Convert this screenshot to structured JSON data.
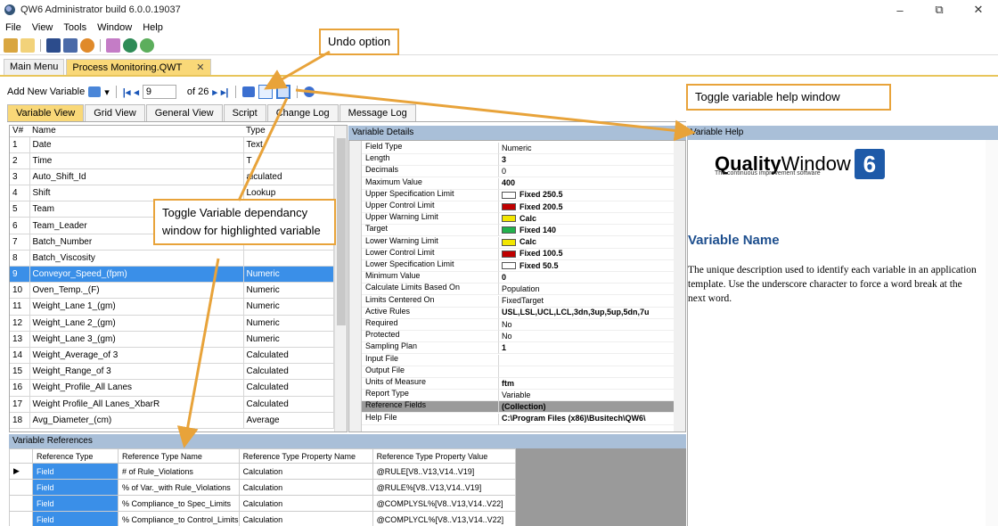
{
  "window": {
    "title": "QW6 Administrator build 6.0.0.19037",
    "controls": [
      "–",
      "⧉",
      "✕"
    ]
  },
  "menu": [
    "File",
    "View",
    "Tools",
    "Window",
    "Help"
  ],
  "doc_tabs": [
    {
      "label": "Main Menu",
      "active": false
    },
    {
      "label": "Process Monitoring.QWT",
      "active": true,
      "close": "✕"
    }
  ],
  "toolbar": {
    "add_label": "Add New Variable",
    "record": "9",
    "of_label": "of 26"
  },
  "view_tabs": [
    "Variable View",
    "Grid View",
    "General View",
    "Script",
    "Change Log",
    "Message Log"
  ],
  "variables": {
    "headers": [
      "V#",
      "Name",
      "Type"
    ],
    "rows": [
      [
        "1",
        "Date",
        "Text"
      ],
      [
        "2",
        "Time",
        "T"
      ],
      [
        "3",
        "Auto_Shift_Id",
        "alculated"
      ],
      [
        "4",
        "Shift",
        "Lookup"
      ],
      [
        "5",
        "Team",
        ""
      ],
      [
        "6",
        "Team_Leader",
        ""
      ],
      [
        "7",
        "Batch_Number",
        ""
      ],
      [
        "8",
        "Batch_Viscosity",
        ""
      ],
      [
        "9",
        "Conveyor_Speed_(fpm)",
        "Numeric"
      ],
      [
        "10",
        "Oven_Temp._(F)",
        "Numeric"
      ],
      [
        "11",
        "Weight_Lane 1_(gm)",
        "Numeric"
      ],
      [
        "12",
        "Weight_Lane 2_(gm)",
        "Numeric"
      ],
      [
        "13",
        "Weight_Lane 3_(gm)",
        "Numeric"
      ],
      [
        "14",
        "Weight_Average_of 3",
        "Calculated"
      ],
      [
        "15",
        "Weight_Range_of 3",
        "Calculated"
      ],
      [
        "16",
        "Weight_Profile_All Lanes",
        "Calculated"
      ],
      [
        "17",
        "Weight Profile_All Lanes_XbarR",
        "Calculated"
      ],
      [
        "18",
        "Avg_Diameter_(cm)",
        "Average"
      ]
    ]
  },
  "details": {
    "header": "Variable Details",
    "props": [
      {
        "name": "Field Type",
        "value": "Numeric"
      },
      {
        "name": "Length",
        "value": "3",
        "bold": true
      },
      {
        "name": "Decimals",
        "value": "0"
      },
      {
        "name": "Maximum Value",
        "value": "400",
        "bold": true
      },
      {
        "name": "Upper Specification Limit",
        "value": "Fixed 250.5",
        "bold": true,
        "swatch": "#ffffff"
      },
      {
        "name": "Upper Control Limit",
        "value": "Fixed 200.5",
        "bold": true,
        "swatch": "#c00000"
      },
      {
        "name": "Upper Warning Limit",
        "value": "Calc",
        "bold": true,
        "swatch": "#f2e600"
      },
      {
        "name": "Target",
        "value": "Fixed 140",
        "bold": true,
        "swatch": "#22b14c"
      },
      {
        "name": "Lower Warning Limit",
        "value": "Calc",
        "bold": true,
        "swatch": "#f2e600"
      },
      {
        "name": "Lower Control Limit",
        "value": "Fixed 100.5",
        "bold": true,
        "swatch": "#c00000"
      },
      {
        "name": "Lower Specification Limit",
        "value": "Fixed 50.5",
        "bold": true,
        "swatch": "#ffffff"
      },
      {
        "name": "Minimum Value",
        "value": "0",
        "bold": true
      },
      {
        "name": "Calculate Limits Based On",
        "value": "Population"
      },
      {
        "name": "Limits Centered On",
        "value": "FixedTarget"
      },
      {
        "name": "Active Rules",
        "value": "USL,LSL,UCL,LCL,3dn,3up,5up,5dn,7u",
        "bold": true
      },
      {
        "name": "Required",
        "value": "No"
      },
      {
        "name": "Protected",
        "value": "No"
      },
      {
        "name": "Sampling Plan",
        "value": "1",
        "bold": true
      },
      {
        "name": "Input File",
        "value": ""
      },
      {
        "name": "Output File",
        "value": ""
      },
      {
        "name": "Units of Measure",
        "value": "ftm",
        "bold": true
      },
      {
        "name": "Report Type",
        "value": "Variable"
      },
      {
        "name": "Reference Fields",
        "value": "(Collection)",
        "bold": true,
        "grey": true
      },
      {
        "name": "Help File",
        "value": "C:\\Program Files (x86)\\Busitech\\QW6\\",
        "bold": true
      }
    ]
  },
  "help": {
    "header": "Variable Help",
    "logo_word1": "Quality",
    "logo_word2": "Window",
    "logo_tag": "The continuous improvement software",
    "logo_num": "6",
    "title": "Variable Name",
    "body": "The unique description used to identify each variable in an application template. Use the underscore character to force a word break at the next word."
  },
  "references": {
    "header": "Variable References",
    "headers": [
      "Reference Type",
      "Reference Type Name",
      "Reference Type Property Name",
      "Reference Type Property Value"
    ],
    "rows": [
      [
        "Field",
        "# of Rule_Violations",
        "Calculation",
        "@RULE[V8..V13,V14..V19]"
      ],
      [
        "Field",
        "% of Var._with Rule_Violations",
        "Calculation",
        "@RULE%[V8..V13,V14..V19]"
      ],
      [
        "Field",
        "% Compliance_to Spec_Limits",
        "Calculation",
        "@COMPLYSL%[V8..V13,V14..V22]"
      ],
      [
        "Field",
        "% Compliance_to Control_Limits",
        "Calculation",
        "@COMPLYCL%[V8..V13,V14..V22]"
      ]
    ]
  },
  "callouts": {
    "undo": "Undo option",
    "help_toggle": "Toggle variable help window",
    "dependency": "Toggle Variable dependancy window for highlighted variable"
  }
}
